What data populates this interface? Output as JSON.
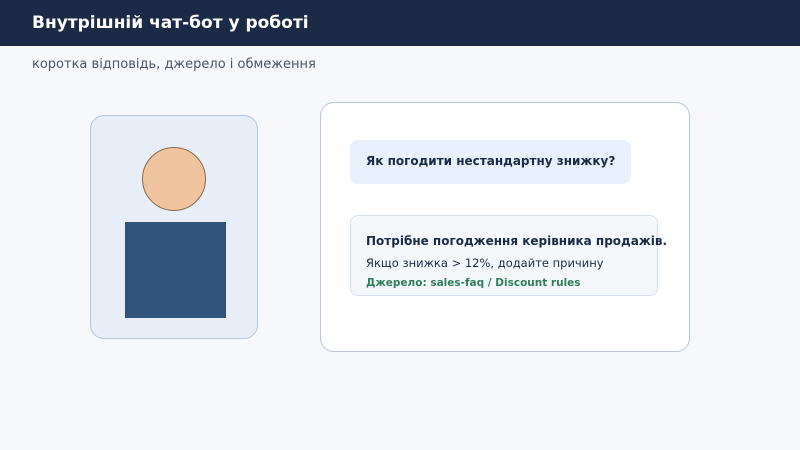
{
  "header": {
    "title": "Внутрішній чат-бот у роботі"
  },
  "subtitle": "коротка відповідь, джерело і обмеження",
  "person": {
    "head_color": "#efc49f",
    "body_color": "#2f537b"
  },
  "chat": {
    "question": "Як погодити нестандартну знижку?",
    "answer": {
      "headline": "Потрібне погодження керівника продажів.",
      "detail": "Якщо знижка > 12%, додайте причину",
      "source": "Джерело: sales-faq / Discount rules"
    }
  },
  "colors": {
    "header_bg": "#1b2a47",
    "page_bg": "#f6f8fb",
    "accent_source": "#2e7d5b",
    "question_bubble": "#e8f1fb"
  }
}
